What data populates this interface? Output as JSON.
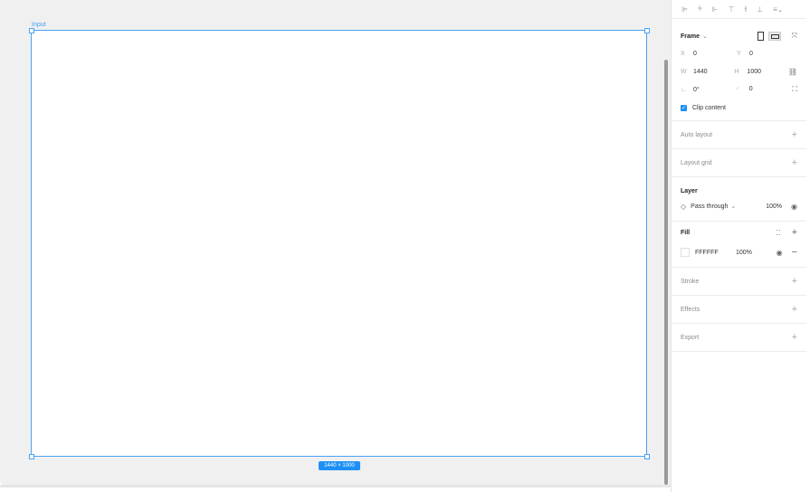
{
  "canvas": {
    "frame_label": "Input",
    "size_badge": "1440 × 1000"
  },
  "align_icons": [
    "align-left-icon",
    "align-center-h-icon",
    "align-right-icon",
    "align-top-icon",
    "align-center-v-icon",
    "align-bottom-icon",
    "distribute-icon"
  ],
  "frame": {
    "title": "Frame",
    "x_label": "X",
    "x_value": "0",
    "y_label": "Y",
    "y_value": "0",
    "w_label": "W",
    "w_value": "1440",
    "h_label": "H",
    "h_value": "1000",
    "rotation_value": "0°",
    "radius_value": "0",
    "clip_label": "Clip content"
  },
  "sections": {
    "auto_layout": "Auto layout",
    "layout_grid": "Layout grid",
    "stroke": "Stroke",
    "effects": "Effects",
    "export": "Export"
  },
  "layer": {
    "title": "Layer",
    "blend": "Pass through",
    "opacity": "100%"
  },
  "fill": {
    "title": "Fill",
    "hex": "FFFFFF",
    "opacity": "100%"
  },
  "colors": {
    "accent": "#1e90f5",
    "frame_border": "#4aa3f5",
    "canvas_bg": "#f0f0f0"
  }
}
